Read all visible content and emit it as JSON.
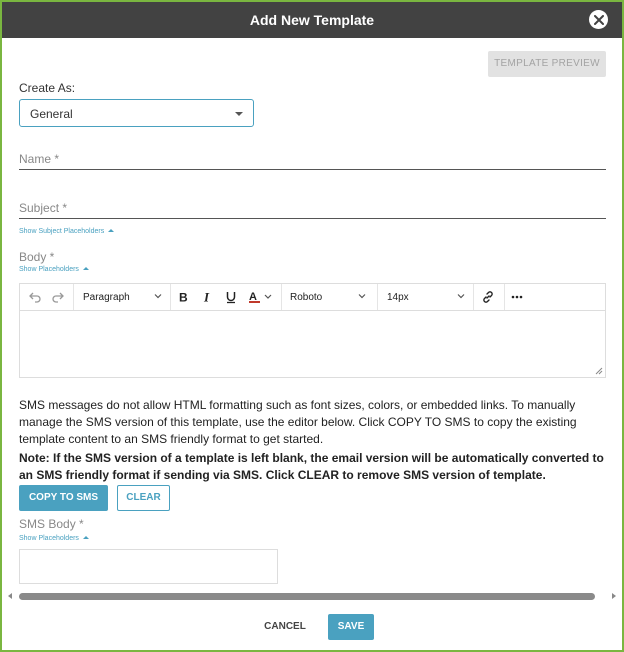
{
  "dialog": {
    "title": "Add New Template",
    "close_icon": "close-icon"
  },
  "toolbar_top": {
    "template_preview_label": "TEMPLATE PREVIEW"
  },
  "form": {
    "create_as_label": "Create As:",
    "create_as_value": "General",
    "name_label": "Name *",
    "subject_label": "Subject *",
    "show_subject_placeholders": "Show Subject Placeholders",
    "body_label": "Body *",
    "show_placeholders": "Show Placeholders"
  },
  "editor": {
    "icons": [
      "undo-icon",
      "redo-icon",
      "bold-icon",
      "italic-icon",
      "underline-icon",
      "text-color-icon",
      "link-icon",
      "more-icon"
    ],
    "block_format": "Paragraph",
    "font_family": "Roboto",
    "font_size": "14px",
    "text_color": "#c0392b"
  },
  "sms": {
    "info_text": "SMS messages do not allow HTML formatting such as font sizes, colors, or embedded links. To manually manage the SMS version of this template, use the editor below. Click COPY TO SMS to copy the existing template content to an SMS friendly format to get started.",
    "note_text": "Note: If the SMS version of a template is left blank, the email version will be automatically converted to an SMS friendly format if sending via SMS. Click CLEAR to remove SMS version of template.",
    "copy_label": "COPY TO SMS",
    "clear_label": "CLEAR",
    "body_label": "SMS Body *",
    "show_placeholders": "Show Placeholders"
  },
  "footer": {
    "cancel_label": "CANCEL",
    "save_label": "SAVE"
  },
  "colors": {
    "accent": "#4aa1c0",
    "header_bg": "#424242",
    "frame_border": "#7ab640"
  }
}
